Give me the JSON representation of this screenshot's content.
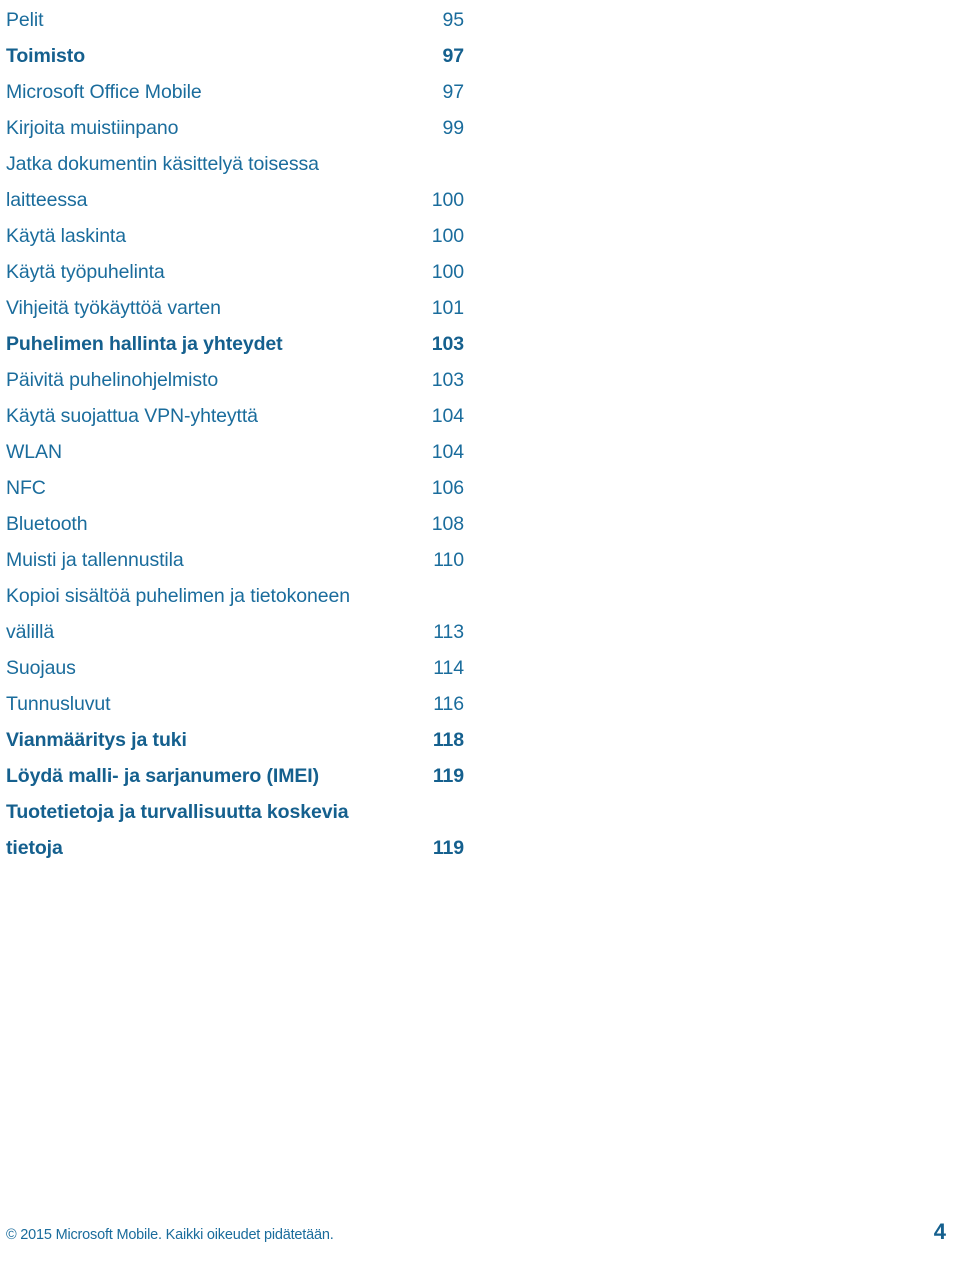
{
  "document": {
    "language": "fi",
    "accent_color": "#1a6c9c",
    "accent_bold_color": "#15608e",
    "background_color": "#ffffff"
  },
  "toc": {
    "entries": [
      {
        "title": "Pelit",
        "page": "95",
        "bold": false,
        "multiline": false
      },
      {
        "title": "Toimisto",
        "page": "97",
        "bold": true,
        "multiline": false
      },
      {
        "title": "Microsoft Office Mobile",
        "page": "97",
        "bold": false,
        "multiline": false
      },
      {
        "title": "Kirjoita muistiinpano",
        "page": "99",
        "bold": false,
        "multiline": false
      },
      {
        "title": "Jatka dokumentin käsittelyä toisessa\nlaitteessa",
        "page": "100",
        "bold": false,
        "multiline": true
      },
      {
        "title": "Käytä laskinta",
        "page": "100",
        "bold": false,
        "multiline": false
      },
      {
        "title": "Käytä työpuhelinta",
        "page": "100",
        "bold": false,
        "multiline": false
      },
      {
        "title": "Vihjeitä työkäyttöä varten",
        "page": "101",
        "bold": false,
        "multiline": false
      },
      {
        "title": "Puhelimen hallinta ja yhteydet",
        "page": "103",
        "bold": true,
        "multiline": false
      },
      {
        "title": "Päivitä puhelinohjelmisto",
        "page": "103",
        "bold": false,
        "multiline": false
      },
      {
        "title": "Käytä suojattua VPN-yhteyttä",
        "page": "104",
        "bold": false,
        "multiline": false
      },
      {
        "title": "WLAN",
        "page": "104",
        "bold": false,
        "multiline": false
      },
      {
        "title": "NFC",
        "page": "106",
        "bold": false,
        "multiline": false
      },
      {
        "title": "Bluetooth",
        "page": "108",
        "bold": false,
        "multiline": false
      },
      {
        "title": "Muisti ja tallennustila",
        "page": "110",
        "bold": false,
        "multiline": false
      },
      {
        "title": "Kopioi sisältöä puhelimen ja tietokoneen\nvälillä",
        "page": "113",
        "bold": false,
        "multiline": true
      },
      {
        "title": "Suojaus",
        "page": "114",
        "bold": false,
        "multiline": false
      },
      {
        "title": "Tunnusluvut",
        "page": "116",
        "bold": false,
        "multiline": false
      },
      {
        "title": "Vianmääritys ja tuki",
        "page": "118",
        "bold": true,
        "multiline": false
      },
      {
        "title": "Löydä malli- ja sarjanumero (IMEI)",
        "page": "119",
        "bold": true,
        "multiline": false
      },
      {
        "title": "Tuotetietoja ja turvallisuutta koskevia\ntietoja",
        "page": "119",
        "bold": true,
        "multiline": true
      }
    ]
  },
  "footer": {
    "copyright": "© 2015 Microsoft Mobile. Kaikki oikeudet pidätetään.",
    "page_number": "4"
  }
}
